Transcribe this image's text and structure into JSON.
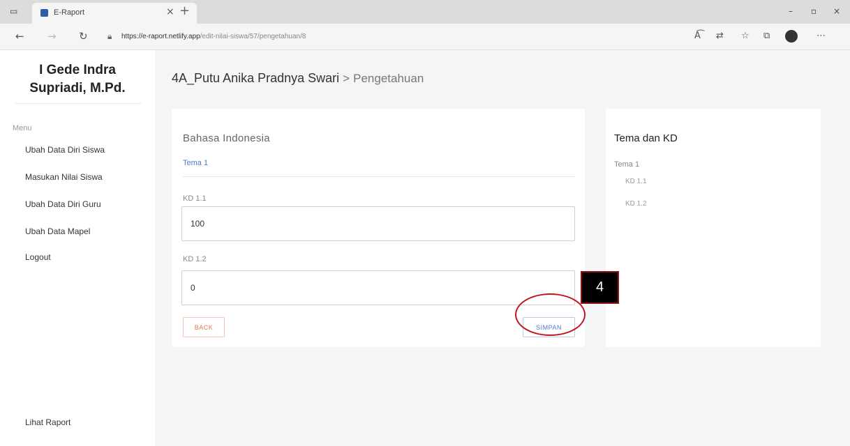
{
  "browser": {
    "tab_title": "E-Raport",
    "tab_close": "×",
    "new_tab": "+",
    "url_host": "https://e-raport.netlify.app",
    "url_path": "/edit-nilai-siswa/57/pengetahuan/8",
    "window_minimize": "–",
    "window_maximize": "▫",
    "window_close": "×",
    "icons": [
      "back-arrow-icon",
      "forward-arrow-icon",
      "refresh-icon",
      "lock-icon",
      "read-aloud-icon",
      "translate-icon",
      "favorites-icon",
      "collections-icon",
      "profile-icon",
      "more-icon"
    ]
  },
  "sidebar": {
    "user_name": "I Gede Indra Supriadi, M.Pd.",
    "menu_title": "Menu",
    "items": [
      {
        "label": "Ubah Data Diri Siswa"
      },
      {
        "label": "Masukan Nilai Siswa"
      },
      {
        "label": "Ubah Data Diri Guru"
      },
      {
        "label": "Ubah Data Mapel"
      },
      {
        "label": "Logout"
      }
    ],
    "footer_link": "Lihat Raport"
  },
  "main": {
    "student": "4A_Putu Anika Pradnya Swari",
    "separator": ">",
    "section": "Pengetahuan",
    "form": {
      "subject": "Bahasa Indonesia",
      "tema": "Tema 1",
      "fields": [
        {
          "label": "KD 1.1",
          "value": "100"
        },
        {
          "label": "KD 1.2",
          "value": "0"
        }
      ],
      "back_label": "BACK",
      "save_label": "SIMPAN"
    },
    "side": {
      "title": "Tema dan KD",
      "tema": "Tema 1",
      "kds": [
        "KD 1.1",
        "KD 1.2"
      ]
    }
  },
  "annotation": {
    "step_number": "4",
    "color": "#c0161c"
  }
}
